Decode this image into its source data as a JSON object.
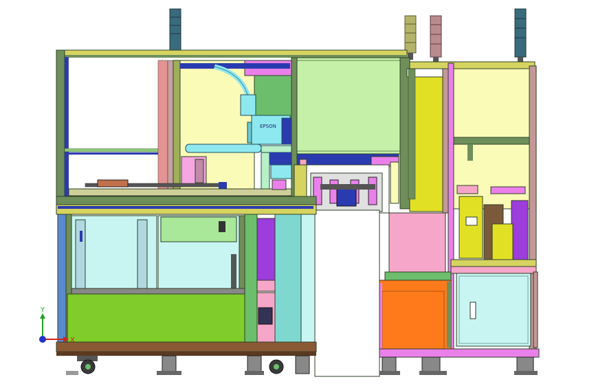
{
  "drawing": {
    "logo_text": "EPSON",
    "axes": {
      "x_label": "X",
      "y_label": "Y"
    }
  },
  "colors": {
    "frame_dark": "#2e3f28",
    "frame_green": "#6f8f5a",
    "frame_yellow": "#d6d460",
    "panel_yellow": "#fbfbb8",
    "panel_light_green": "#c4f0a8",
    "panel_cyan": "#c8f5f2",
    "panel_lime": "#7fcc2a",
    "panel_orange": "#ff7a1a",
    "panel_pink": "#f6a6c8",
    "panel_magenta": "#ea80ea",
    "panel_violet": "#9c3ddc",
    "panel_teal": "#7ed8d0",
    "robot_cyan": "#8ee8ef",
    "base_brown": "#8a5a35",
    "axis_x": "#d22222",
    "axis_y": "#22a022",
    "axis_z": "#2233cc"
  }
}
